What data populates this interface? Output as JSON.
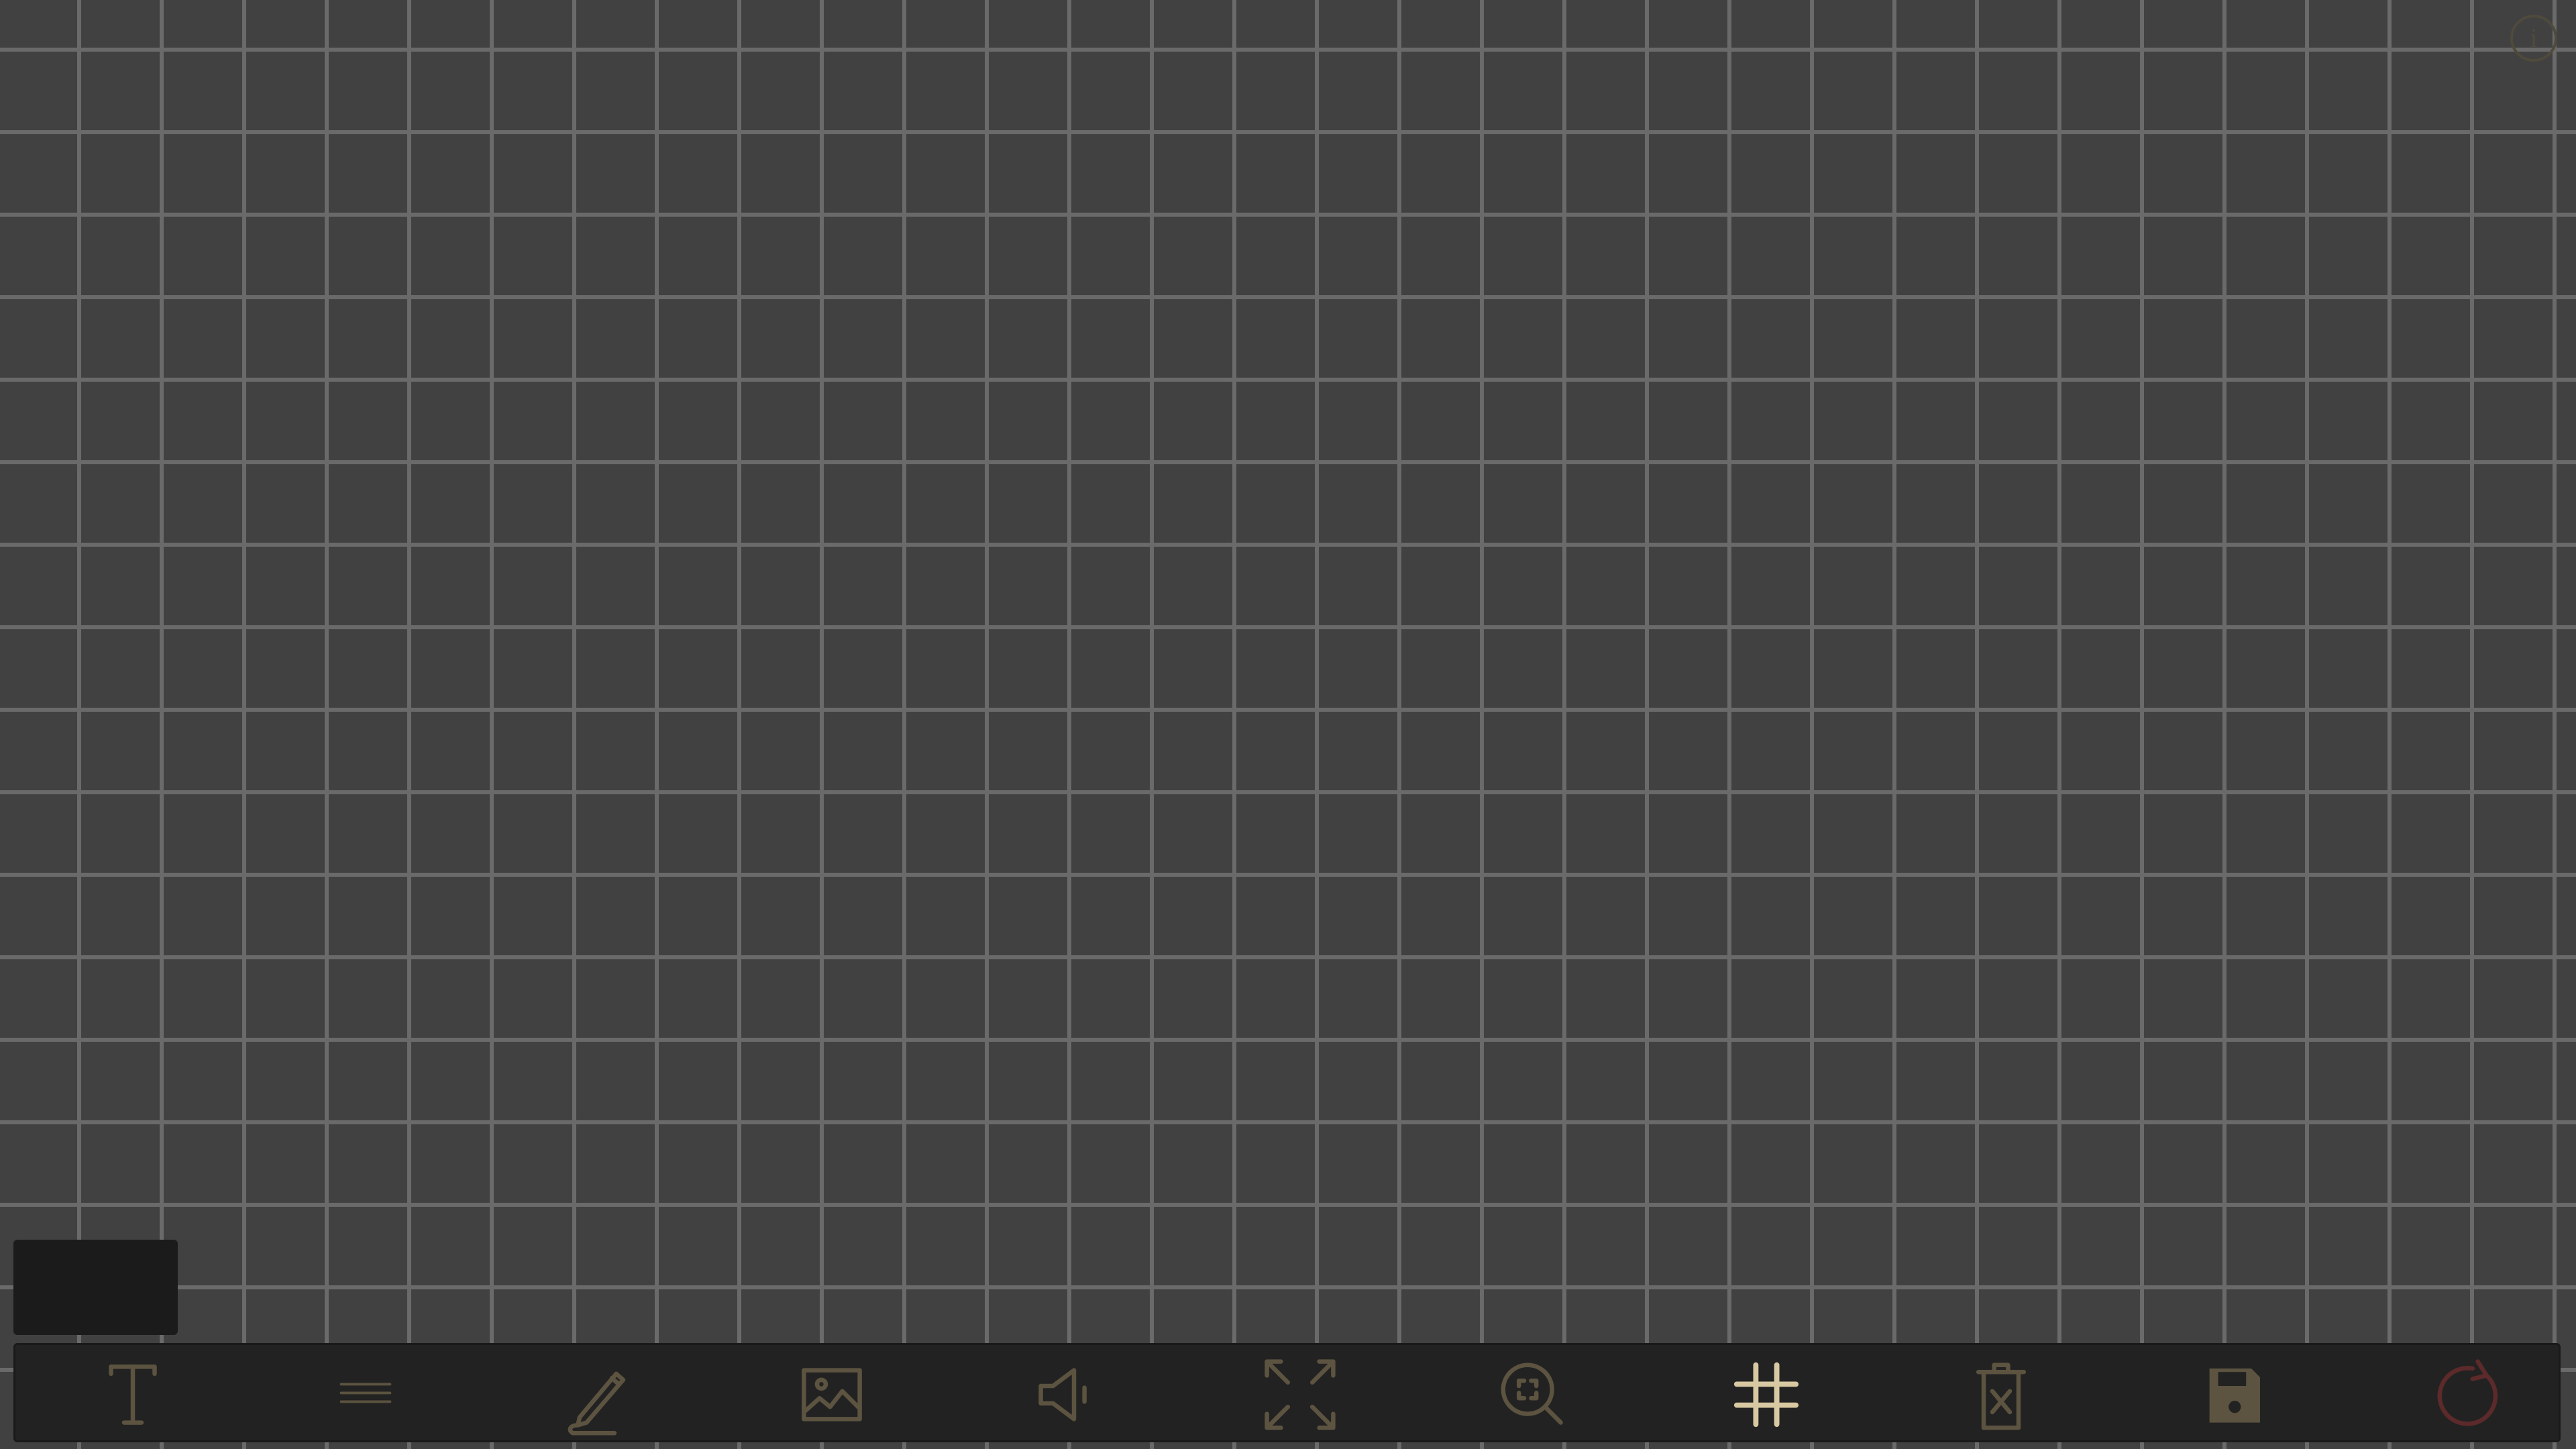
{
  "canvas": {
    "background_color": "#414141",
    "grid_color": "#6a6a6a",
    "grid_visible": true
  },
  "info_button": {
    "icon": "info-icon",
    "glyph": "i"
  },
  "color_swatch": {
    "color": "#1b1b1b"
  },
  "toolbar": {
    "accent_color": "#d8c9a2",
    "dim_color": "#5c5340",
    "tools": [
      {
        "id": "text",
        "icon": "text-tool-icon",
        "active": false
      },
      {
        "id": "list",
        "icon": "list-icon",
        "active": false
      },
      {
        "id": "pen",
        "icon": "pencil-icon",
        "active": false
      },
      {
        "id": "image",
        "icon": "image-icon",
        "active": false
      },
      {
        "id": "sound",
        "icon": "speaker-icon",
        "active": false
      },
      {
        "id": "fullscreen",
        "icon": "expand-icon",
        "active": false
      },
      {
        "id": "zoom",
        "icon": "zoom-fit-icon",
        "active": false
      },
      {
        "id": "grid",
        "icon": "grid-hash-icon",
        "active": true
      },
      {
        "id": "clear",
        "icon": "trash-icon",
        "active": false
      },
      {
        "id": "save",
        "icon": "save-icon",
        "active": false
      },
      {
        "id": "reset",
        "icon": "refresh-icon",
        "active": false
      }
    ]
  }
}
